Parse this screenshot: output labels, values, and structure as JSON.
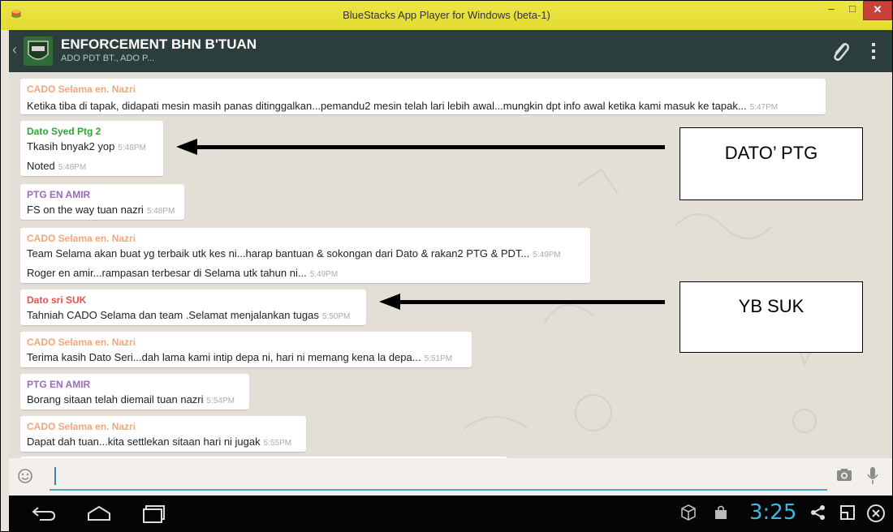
{
  "window": {
    "title": "BlueStacks App Player for Windows (beta-1)",
    "min_glyph": "–",
    "max_glyph": "□",
    "close_glyph": "✕"
  },
  "header": {
    "chat_title": "ENFORCEMENT BHN B'TUAN",
    "chat_subtitle": "ADO PDT BT., ADO P..."
  },
  "messages": [
    {
      "sender": "CADO Selama en. Nazri",
      "sender_color": "#f0a77a",
      "lines": [
        {
          "text": "Ketika tiba di tapak, didapati mesin masih panas ditinggalkan...pemandu2 mesin telah lari lebih awal...mungkin dpt info awal ketika kami masuk ke tapak...",
          "time": "5:47PM"
        }
      ]
    },
    {
      "sender": "Dato Syed Ptg 2",
      "sender_color": "#31a33a",
      "lines": [
        {
          "text": "Tkasih bnyak2 yop",
          "time": "5:48PM"
        },
        {
          "text": "Noted",
          "time": "5:48PM"
        }
      ]
    },
    {
      "sender": "PTG EN AMIR",
      "sender_color": "#9a6bb8",
      "lines": [
        {
          "text": "FS on the way tuan nazri",
          "time": "5:48PM"
        }
      ]
    },
    {
      "sender": "CADO Selama en. Nazri",
      "sender_color": "#f0a77a",
      "lines": [
        {
          "text": "Team Selama akan buat yg terbaik utk kes ni...harap bantuan & sokongan dari Dato & rakan2 PTG & PDT...",
          "time": "5:49PM"
        },
        {
          "text": "Roger en amir...rampasan terbesar di Selama utk tahun ni...",
          "time": "5:49PM"
        }
      ]
    },
    {
      "sender": "Dato sri SUK",
      "sender_color": "#e0544f",
      "lines": [
        {
          "text": "Tahniah CADO Selama dan team .Selamat menjalankan tugas",
          "time": "5:50PM"
        }
      ]
    },
    {
      "sender": "CADO Selama en. Nazri",
      "sender_color": "#f0a77a",
      "lines": [
        {
          "text": "Terima kasih Dato Seri...dah lama kami intip depa ni, hari ni memang kena la depa...",
          "time": "5:51PM"
        }
      ]
    },
    {
      "sender": "PTG EN AMIR",
      "sender_color": "#9a6bb8",
      "lines": [
        {
          "text": "Borang sitaan telah diemail tuan nazri",
          "time": "5:54PM"
        }
      ]
    },
    {
      "sender": "CADO Selama en. Nazri",
      "sender_color": "#f0a77a",
      "lines": [
        {
          "text": "Dapat dah tuan...kita settlekan sitaan hari ni jugak",
          "time": "5:55PM"
        }
      ]
    }
  ],
  "annotations": {
    "dato_ptg": "DATO’ PTG",
    "yb_suk": "YB SUK"
  },
  "input": {
    "value": "",
    "placeholder": ""
  },
  "status": {
    "clock": "3:25"
  },
  "colors": {
    "accent": "#3fb8dd",
    "actionbar": "#2c3e3b",
    "titlebar": "#e3dc2f"
  }
}
